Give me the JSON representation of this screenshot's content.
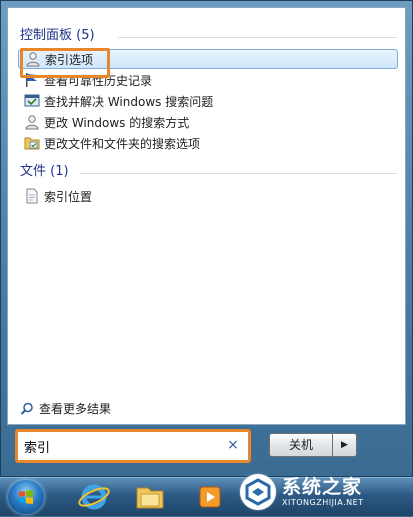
{
  "start_menu": {
    "groups": [
      {
        "header": "控制面板 (5)",
        "items": [
          {
            "label": "索引选项",
            "icon": "user-search-icon"
          },
          {
            "label": "查看可靠性历史记录",
            "icon": "flag-icon"
          },
          {
            "label": "查找并解决 Windows 搜索问题",
            "icon": "troubleshoot-icon"
          },
          {
            "label": "更改 Windows 的搜索方式",
            "icon": "user-search-icon"
          },
          {
            "label": "更改文件和文件夹的搜索选项",
            "icon": "folder-options-icon"
          }
        ]
      },
      {
        "header": "文件 (1)",
        "items": [
          {
            "label": "索引位置",
            "icon": "document-icon"
          }
        ]
      }
    ],
    "see_more": "查看更多结果",
    "search": {
      "value": "索引",
      "clear_glyph": "×"
    },
    "shutdown": {
      "label": "关机",
      "arrow_glyph": "▶"
    }
  },
  "taskbar": {
    "items": [
      "start-orb",
      "internet-explorer-icon",
      "file-explorer-icon",
      "media-player-icon"
    ]
  },
  "watermark": {
    "title": "系统之家",
    "subtitle": "XITONGZHIJIA.NET"
  },
  "colors": {
    "highlight_box": "#e8862c",
    "group_header": "#1e3287",
    "selection": "#cfe6fb"
  }
}
